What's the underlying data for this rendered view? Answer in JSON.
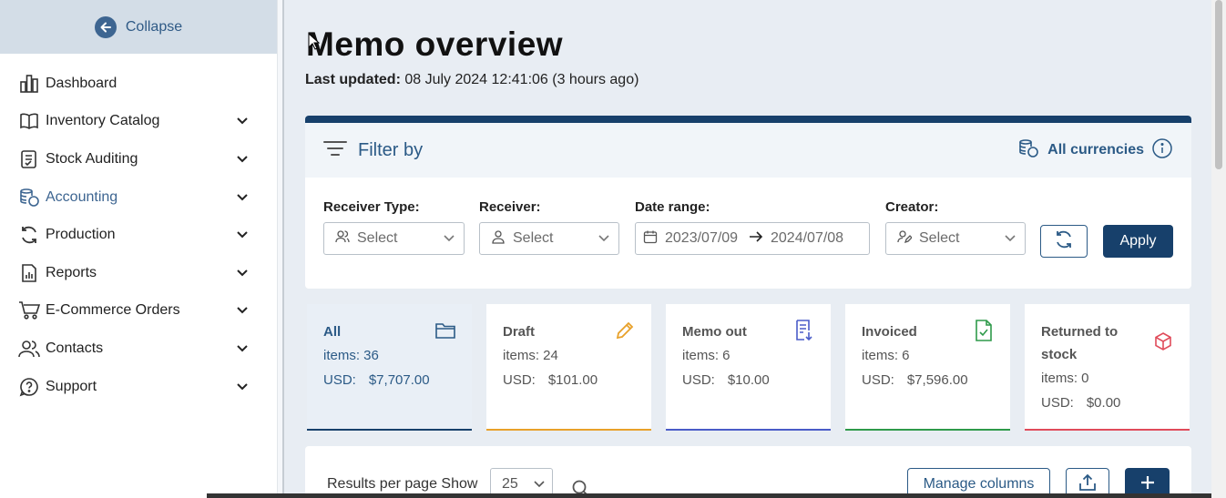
{
  "sidebar": {
    "collapse_label": "Collapse",
    "items": [
      {
        "label": "Dashboard",
        "icon": "chart-bar-icon",
        "has_chevron": false
      },
      {
        "label": "Inventory Catalog",
        "icon": "book-icon",
        "has_chevron": true
      },
      {
        "label": "Stock Auditing",
        "icon": "clipboard-check-icon",
        "has_chevron": true
      },
      {
        "label": "Accounting",
        "icon": "coins-icon",
        "has_chevron": true,
        "active": true
      },
      {
        "label": "Production",
        "icon": "refresh-icon",
        "has_chevron": true
      },
      {
        "label": "Reports",
        "icon": "report-icon",
        "has_chevron": true
      },
      {
        "label": "E-Commerce Orders",
        "icon": "cart-icon",
        "has_chevron": true
      },
      {
        "label": "Contacts",
        "icon": "users-icon",
        "has_chevron": true
      },
      {
        "label": "Support",
        "icon": "help-icon",
        "has_chevron": true
      }
    ]
  },
  "header": {
    "title": "Memo overview",
    "last_updated_label": "Last updated:",
    "last_updated_value": "08 July 2024 12:41:06 (3 hours ago)"
  },
  "filter": {
    "title": "Filter by",
    "currency_label": "All currencies",
    "receiver_type": {
      "label": "Receiver Type:",
      "value": "Select"
    },
    "receiver": {
      "label": "Receiver:",
      "value": "Select"
    },
    "date_range": {
      "label": "Date range:",
      "from": "2023/07/09",
      "to": "2024/07/08"
    },
    "creator": {
      "label": "Creator:",
      "value": "Select"
    },
    "apply_label": "Apply"
  },
  "status_cards": [
    {
      "title": "All",
      "items_label": "items: 36",
      "currency": "USD:",
      "amount": "$7,707.00",
      "color": "#17406b",
      "icon": "folder-icon"
    },
    {
      "title": "Draft",
      "items_label": "items: 24",
      "currency": "USD:",
      "amount": "$101.00",
      "color": "#e8a12a",
      "icon": "pencil-icon"
    },
    {
      "title": "Memo out",
      "items_label": "items: 6",
      "currency": "USD:",
      "amount": "$10.00",
      "color": "#4a5cc8",
      "icon": "memo-out-icon"
    },
    {
      "title": "Invoiced",
      "items_label": "items: 6",
      "currency": "USD:",
      "amount": "$7,596.00",
      "color": "#2e9a4a",
      "icon": "invoice-check-icon"
    },
    {
      "title": "Returned to stock",
      "items_label": "items: 0",
      "currency": "USD:",
      "amount": "$0.00",
      "color": "#e04b5a",
      "icon": "box-icon"
    }
  ],
  "results": {
    "per_page_label": "Results per page Show",
    "per_page_value": "25",
    "manage_columns_label": "Manage columns"
  },
  "colors": {
    "primary": "#17406b",
    "accent": "#2b5a86"
  }
}
